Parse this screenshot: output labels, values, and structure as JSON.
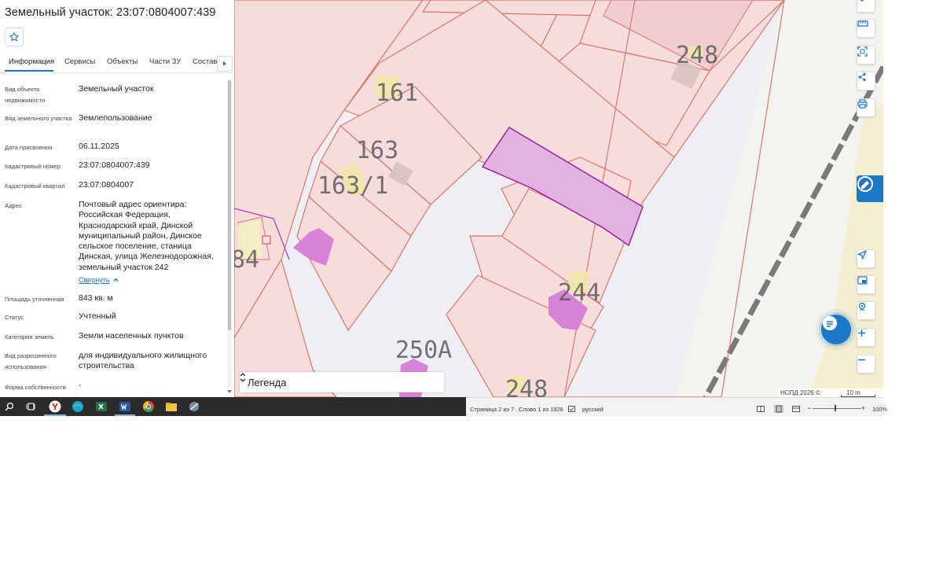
{
  "panel": {
    "title": "Земельный участок: 23:07:0804007:439",
    "tabs": [
      {
        "label": "Информация",
        "active": true
      },
      {
        "label": "Сервисы"
      },
      {
        "label": "Объекты"
      },
      {
        "label": "Части ЗУ"
      },
      {
        "label": "Состав"
      }
    ],
    "rows": [
      {
        "label": "Вид объекта недвижимости",
        "value": "Земельный участок"
      },
      {
        "label": "Вид земельного участка",
        "value": "Землепользование"
      },
      {
        "label": "Дата присвоения",
        "value": "06.11.2025"
      },
      {
        "label": "Кадастровый номер",
        "value": "23:07:0804007:439"
      },
      {
        "label": "Кадастровый квартал",
        "value": "23:07:0804007"
      },
      {
        "label": "Адрес",
        "value": "Почтовый адрес ориентира: Российская Федерация, Краснодарский край, Динской муниципальный район, Динское сельское поселение, станица Динская, улица Железнодорожная, земельный участок 242"
      },
      {
        "label": "Площадь уточненная",
        "value": "843 кв. м"
      },
      {
        "label": "Статус",
        "value": "Учтенный"
      },
      {
        "label": "Категория земель",
        "value": "Земли населенных пунктов"
      },
      {
        "label": "Вид разрешенного использования",
        "value": "для индивидуального жилищного строительства"
      },
      {
        "label": "Форма собственности",
        "value": "-"
      }
    ],
    "collapse_label": "Свернуть"
  },
  "map": {
    "lot_labels": [
      "161",
      "163",
      "163/1",
      "248",
      "244",
      "250А",
      "248",
      "84"
    ],
    "legend_label": "Легенда",
    "copyright": "НСПД 2026 ©",
    "scale_label": "10 m",
    "colors": {
      "selected_fill": "#e2b3e0",
      "selected_stroke": "#9a239a",
      "lot_fill": "#f6dcdb",
      "lot_stroke": "#d9776a",
      "building": "#d683d8"
    }
  },
  "taskbar": {
    "icons": [
      "search-icon",
      "task-view-icon",
      "yandex-browser-icon",
      "edge-icon",
      "excel-icon",
      "word-icon",
      "chrome-icon",
      "file-explorer-icon",
      "app-icon"
    ]
  },
  "word_status": {
    "page": "Страница 2 из 7",
    "words": "Слово 1 из 1926",
    "language": "русский",
    "zoom": "100%"
  }
}
